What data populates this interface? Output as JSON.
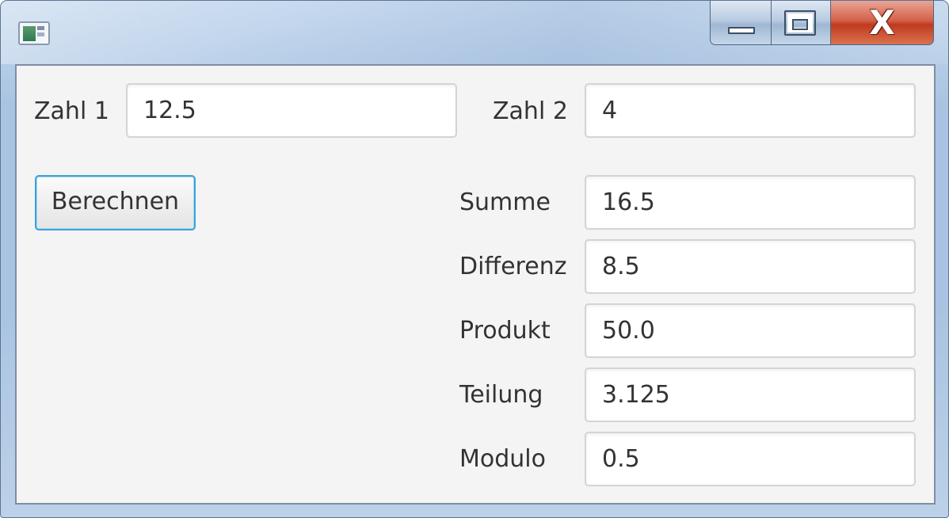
{
  "window": {
    "title": "",
    "icons": {
      "app": "application-window-icon",
      "minimize": "minimize-icon",
      "maximize": "maximize-icon",
      "close": "close-icon"
    },
    "close_glyph": "X"
  },
  "inputs": {
    "zahl1": {
      "label": "Zahl 1",
      "value": "12.5"
    },
    "zahl2": {
      "label": "Zahl 2",
      "value": "4"
    }
  },
  "actions": {
    "calculate_label": "Berechnen"
  },
  "results": {
    "summe": {
      "label": "Summe",
      "value": "16.5"
    },
    "differenz": {
      "label": "Differenz",
      "value": "8.5"
    },
    "produkt": {
      "label": "Produkt",
      "value": "50.0"
    },
    "teilung": {
      "label": "Teilung",
      "value": "3.125"
    },
    "modulo": {
      "label": "Modulo",
      "value": "0.5"
    }
  },
  "colors": {
    "focus_ring": "#3aa3d8",
    "close_button": "#c13a1f",
    "client_background": "#f4f4f4"
  }
}
